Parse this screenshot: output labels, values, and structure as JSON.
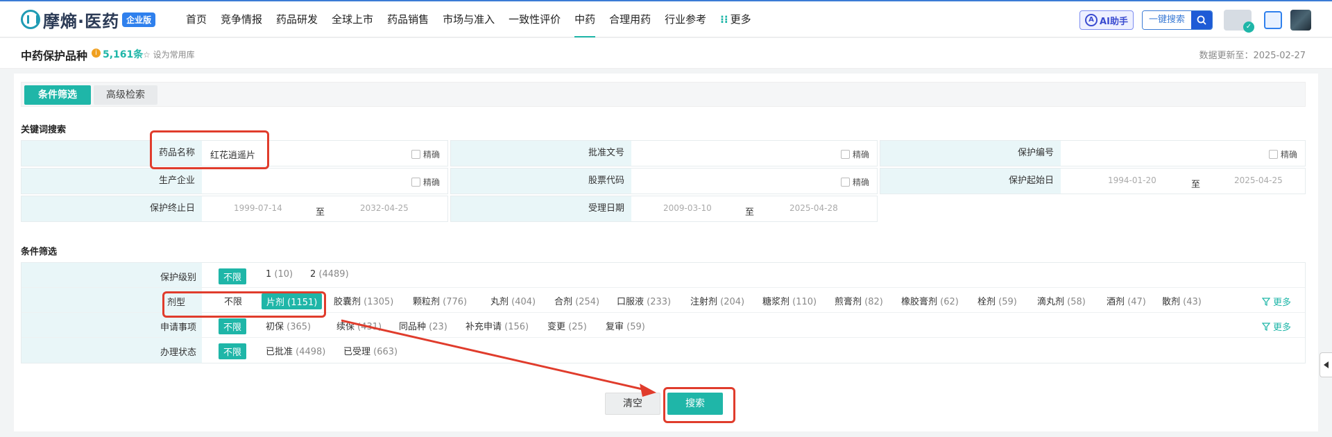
{
  "brand": {
    "name": "摩熵·医药",
    "badge": "企业版"
  },
  "nav": {
    "items": [
      "首页",
      "竞争情报",
      "药品研发",
      "全球上市",
      "药品销售",
      "市场与准入",
      "一致性评价",
      "中药",
      "合理用药",
      "行业参考"
    ],
    "active_index": 7,
    "more": "更多",
    "ai_label": "AI助手",
    "quick_search": "一键搜索"
  },
  "header": {
    "title": "中药保护品种",
    "count": "5,161条",
    "favorite": "设为常用库",
    "updated": "数据更新至：2025-02-27"
  },
  "tabs": {
    "active": "条件筛选",
    "inactive": "高级检索"
  },
  "keyword": {
    "section_label": "关键词搜索",
    "exact": "精确",
    "drug_name": {
      "label": "药品名称",
      "value": "红花逍遥片"
    },
    "approval_no": {
      "label": "批准文号"
    },
    "protect_no": {
      "label": "保护编号"
    },
    "manufacturer": {
      "label": "生产企业"
    },
    "stock_code": {
      "label": "股票代码"
    },
    "protect_start": {
      "label": "保护起始日",
      "from": "1994-01-20",
      "to": "2025-04-25"
    },
    "protect_end": {
      "label": "保护终止日",
      "from": "1999-07-14",
      "to": "2032-04-25"
    },
    "accept_date": {
      "label": "受理日期",
      "from": "2009-03-10",
      "to": "2025-04-28"
    },
    "range_sep": "至"
  },
  "filters": {
    "section_label": "条件筛选",
    "more": "更多",
    "level": {
      "label": "保护级别",
      "options": [
        {
          "text": "不限",
          "cnt": ""
        },
        {
          "text": "1",
          "cnt": "(10)"
        },
        {
          "text": "2",
          "cnt": "(4489)"
        }
      ]
    },
    "dosage": {
      "label": "剂型",
      "options": [
        {
          "text": "不限",
          "cnt": ""
        },
        {
          "text": "片剂",
          "cnt": "(1151)"
        },
        {
          "text": "胶囊剂",
          "cnt": "(1305)"
        },
        {
          "text": "颗粒剂",
          "cnt": "(776)"
        },
        {
          "text": "丸剂",
          "cnt": "(404)"
        },
        {
          "text": "合剂",
          "cnt": "(254)"
        },
        {
          "text": "口服液",
          "cnt": "(233)"
        },
        {
          "text": "注射剂",
          "cnt": "(204)"
        },
        {
          "text": "糖浆剂",
          "cnt": "(110)"
        },
        {
          "text": "煎膏剂",
          "cnt": "(82)"
        },
        {
          "text": "橡胶膏剂",
          "cnt": "(62)"
        },
        {
          "text": "栓剂",
          "cnt": "(59)"
        },
        {
          "text": "滴丸剂",
          "cnt": "(58)"
        },
        {
          "text": "酒剂",
          "cnt": "(47)"
        },
        {
          "text": "散剂",
          "cnt": "(43)"
        }
      ]
    },
    "apply": {
      "label": "申请事项",
      "options": [
        {
          "text": "不限",
          "cnt": ""
        },
        {
          "text": "初保",
          "cnt": "(365)"
        },
        {
          "text": "续保",
          "cnt": "(431)"
        },
        {
          "text": "同品种",
          "cnt": "(23)"
        },
        {
          "text": "补充申请",
          "cnt": "(156)"
        },
        {
          "text": "变更",
          "cnt": "(25)"
        },
        {
          "text": "复审",
          "cnt": "(59)"
        }
      ]
    },
    "status": {
      "label": "办理状态",
      "options": [
        {
          "text": "不限",
          "cnt": ""
        },
        {
          "text": "已批准",
          "cnt": "(4498)"
        },
        {
          "text": "已受理",
          "cnt": "(663)"
        }
      ]
    }
  },
  "actions": {
    "clear": "清空",
    "search": "搜索"
  },
  "colors": {
    "accent": "#1fb6a8",
    "highlight": "#e03c2c",
    "brand": "#2f80ed"
  }
}
